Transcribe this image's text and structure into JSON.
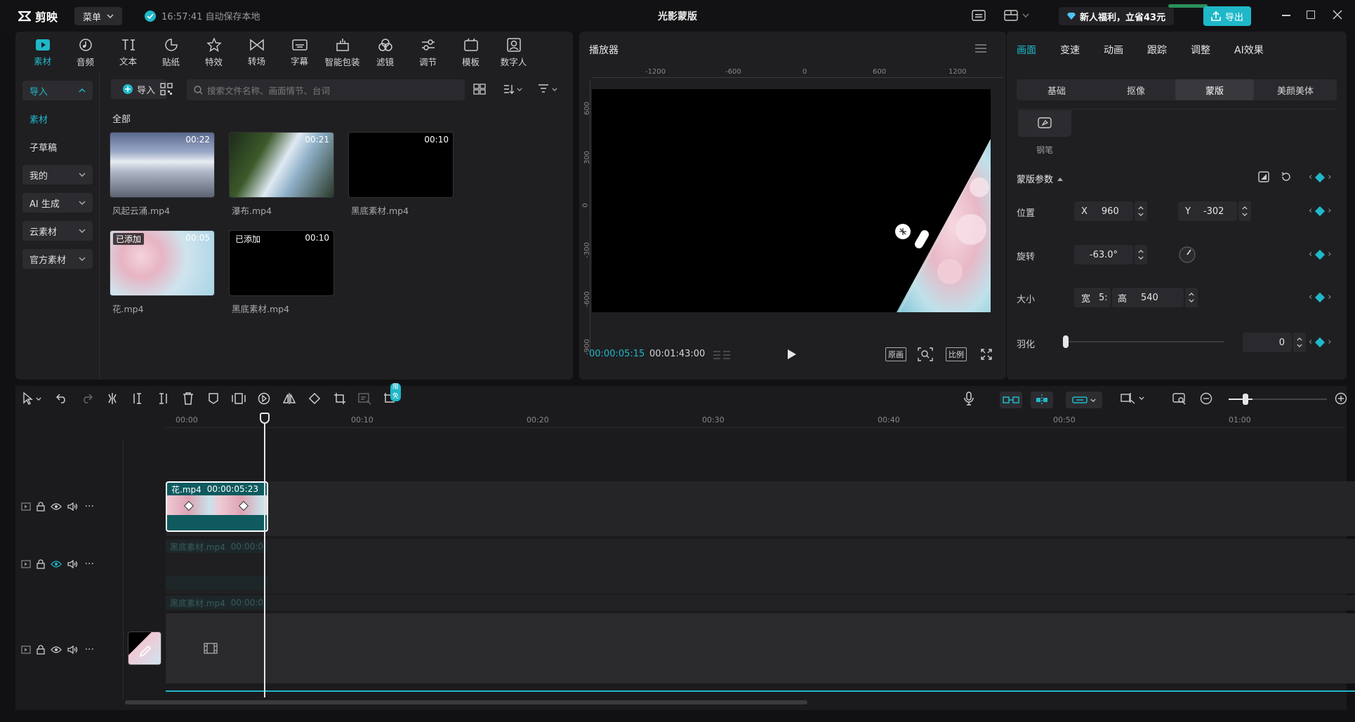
{
  "app": {
    "logo_text": "剪映",
    "menu_label": "菜单",
    "autosave_text": "16:57:41 自动保存本地",
    "project_title": "光影蒙版",
    "promo_text": "新人福利，立省43元",
    "export_label": "导出"
  },
  "media_toolbar": [
    {
      "label": "素材",
      "icon": "media-icon"
    },
    {
      "label": "音频",
      "icon": "audio-icon"
    },
    {
      "label": "文本",
      "icon": "text-icon"
    },
    {
      "label": "贴纸",
      "icon": "sticker-icon"
    },
    {
      "label": "特效",
      "icon": "effects-icon"
    },
    {
      "label": "转场",
      "icon": "transition-icon"
    },
    {
      "label": "字幕",
      "icon": "subtitle-icon"
    },
    {
      "label": "智能包装",
      "icon": "smart-pack-icon"
    },
    {
      "label": "滤镜",
      "icon": "filter-icon"
    },
    {
      "label": "调节",
      "icon": "adjust-icon"
    },
    {
      "label": "模板",
      "icon": "template-icon"
    },
    {
      "label": "数字人",
      "icon": "avatar-icon"
    }
  ],
  "media_sidebar": {
    "import_section": "导入",
    "items": [
      "素材",
      "子草稿"
    ],
    "groups": [
      "我的",
      "AI 生成",
      "云素材",
      "官方素材"
    ]
  },
  "media_main": {
    "import_button": "导入",
    "search_placeholder": "搜索文件名称、画面情节、台词",
    "section_all": "全部",
    "clips": [
      {
        "name": "风起云涌.mp4",
        "duration": "00:22",
        "added": ""
      },
      {
        "name": "瀑布.mp4",
        "duration": "00:21",
        "added": ""
      },
      {
        "name": "黑底素材.mp4",
        "duration": "00:10",
        "added": ""
      },
      {
        "name": "花.mp4",
        "duration": "00:05",
        "added": "已添加"
      },
      {
        "name": "黑底素材.mp4",
        "duration": "00:10",
        "added": "已添加"
      }
    ]
  },
  "player": {
    "title": "播放器",
    "ruler_h": [
      "-1200",
      "-600",
      "0",
      "600",
      "1200"
    ],
    "ruler_v": [
      "600",
      "300",
      "0",
      "-300",
      "-600",
      "-900"
    ],
    "current_time": "00:00:05:15",
    "total_time": "00:01:43:00",
    "btn_original": "原画",
    "btn_ratio": "比例"
  },
  "props": {
    "tabs": [
      "画面",
      "变速",
      "动画",
      "跟踪",
      "调整",
      "AI效果"
    ],
    "subtabs": [
      "基础",
      "抠像",
      "蒙版",
      "美颜美体"
    ],
    "pen_label": "钢笔",
    "section_title": "蒙版参数",
    "position_label": "位置",
    "x_label": "X",
    "x_value": "960",
    "y_label": "Y",
    "y_value": "-302",
    "rotation_label": "旋转",
    "rotation_value": "-63.0°",
    "size_label": "大小",
    "width_label": "宽",
    "width_value": "5:",
    "height_label": "高",
    "height_value": "540",
    "feather_label": "羽化",
    "feather_value": "0",
    "feather_level": 0
  },
  "timeline": {
    "badge": "限免",
    "ruler": [
      "00:00",
      "00:10",
      "00:20",
      "00:30",
      "00:40",
      "00:50",
      "01:00"
    ],
    "clip_main": {
      "name": "花.mp4",
      "duration": "00:00:05:23"
    },
    "clip_black1": {
      "name": "黑底素材.mp4",
      "duration": "00:00:0"
    },
    "clip_black2": {
      "name": "黑底素材.mp4",
      "duration": "00:00:0"
    }
  },
  "colors": {
    "accent": "#1fb8c9",
    "panel": "#1f1f22",
    "clip_teal": "#0e5a5e"
  }
}
